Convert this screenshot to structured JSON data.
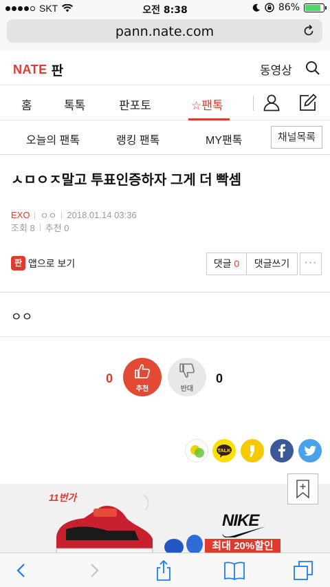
{
  "status_bar": {
    "carrier": "SKT",
    "time": "오전 8:38",
    "battery_percent": "86%",
    "battery_level": 0.86
  },
  "browser": {
    "url": "pann.nate.com"
  },
  "header": {
    "logo_nate": "NATE",
    "logo_pan": "판",
    "video_link": "동영상"
  },
  "main_nav": {
    "items": [
      "홈",
      "톡톡",
      "판포토",
      "☆팬톡"
    ],
    "active_index": 3
  },
  "sub_nav": {
    "items": [
      "오늘의 팬톡",
      "랭킹 팬톡",
      "MY팬톡"
    ],
    "channel_list": "채널목록"
  },
  "post": {
    "title": "ㅅㅁㅇㅈ말고 투표인증하자 그게 더 빡셈",
    "category": "EXO",
    "author": "ㅇㅇ",
    "date": "2018.01.14 03:36",
    "views": "조회 8",
    "recommend_count_label": "추천 0",
    "body": "ㅇㅇ"
  },
  "actions": {
    "app_view": "앱으로 보기",
    "app_icon": "판",
    "comment_label": "댓글",
    "comment_count": "0",
    "write_comment": "댓글쓰기",
    "more": "···"
  },
  "vote": {
    "up_count": "0",
    "up_label": "추천",
    "down_label": "반대",
    "down_count": "0"
  },
  "share_icons": [
    "band-icon",
    "kakaotalk-icon",
    "kakaostory-icon",
    "facebook-icon",
    "twitter-icon"
  ],
  "share": {
    "kakaotalk_text": "TALK"
  },
  "ad": {
    "brand_11st": "11번가",
    "brand_nike": "NIKE",
    "sale": "최대 20%할인"
  },
  "colors": {
    "accent": "#e03a2e",
    "facebook": "#3b5998",
    "twitter": "#4aa1eb",
    "kakao": "#f9e000"
  }
}
